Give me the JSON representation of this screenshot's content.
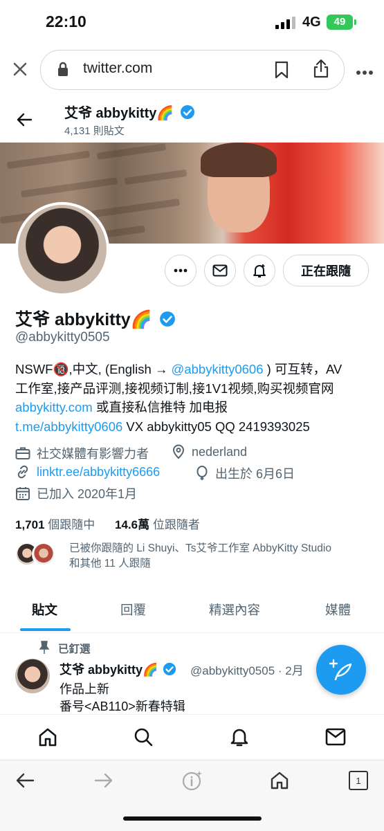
{
  "status_bar": {
    "time": "22:10",
    "network": "4G",
    "battery": "49"
  },
  "browser": {
    "url": "twitter.com"
  },
  "header": {
    "name": "艾爷 abbykitty🌈",
    "post_count": "4,131 則貼文"
  },
  "profile": {
    "name": "艾爷 abbykitty🌈",
    "handle": "@abbykitty0505",
    "follow_button": "正在跟隨",
    "bio": {
      "l1_a": "NSWF🔞,中文, (English → ",
      "l1_link": "@abbykitty0606",
      "l1_b": " ) 可互转，AV",
      "l2": "工作室,接产品评测,接视频订制,接1V1视频,购买视频官网",
      "l3_link": "abbykitty.com",
      "l3_b": " 或直接私信推特 加电报",
      "l4_link": "t.me/abbykitty0606",
      "l4_b": " VX abbykitty05 QQ 2419393025"
    },
    "category": "社交媒體有影響力者",
    "location": "nederland",
    "website": "linktr.ee/abbykitty6666",
    "birthday": "出生於 6月6日",
    "joined": "已加入 2020年1月",
    "following_count": "1,701",
    "following_label": " 個跟隨中",
    "followers_count": "14.6萬",
    "followers_label": " 位跟隨者",
    "followed_by_line1": "已被你跟隨的 Li Shuyi、Ts艾爷工作室 AbbyKitty Studio",
    "followed_by_line2": "和其他 11 人跟隨"
  },
  "tabs": [
    "貼文",
    "回覆",
    "精選內容",
    "媒體"
  ],
  "pinned_post": {
    "pinned_label": "已釘選",
    "name": "艾爷 abbykitty🌈",
    "handle": "@abbykitty0505 · 2月",
    "line1": "作品上新",
    "line2": "番号<AB110>新春特辑"
  },
  "colors": {
    "accent": "#1d9bf0",
    "verified": "#1d9bf0",
    "battery": "#34c759"
  }
}
